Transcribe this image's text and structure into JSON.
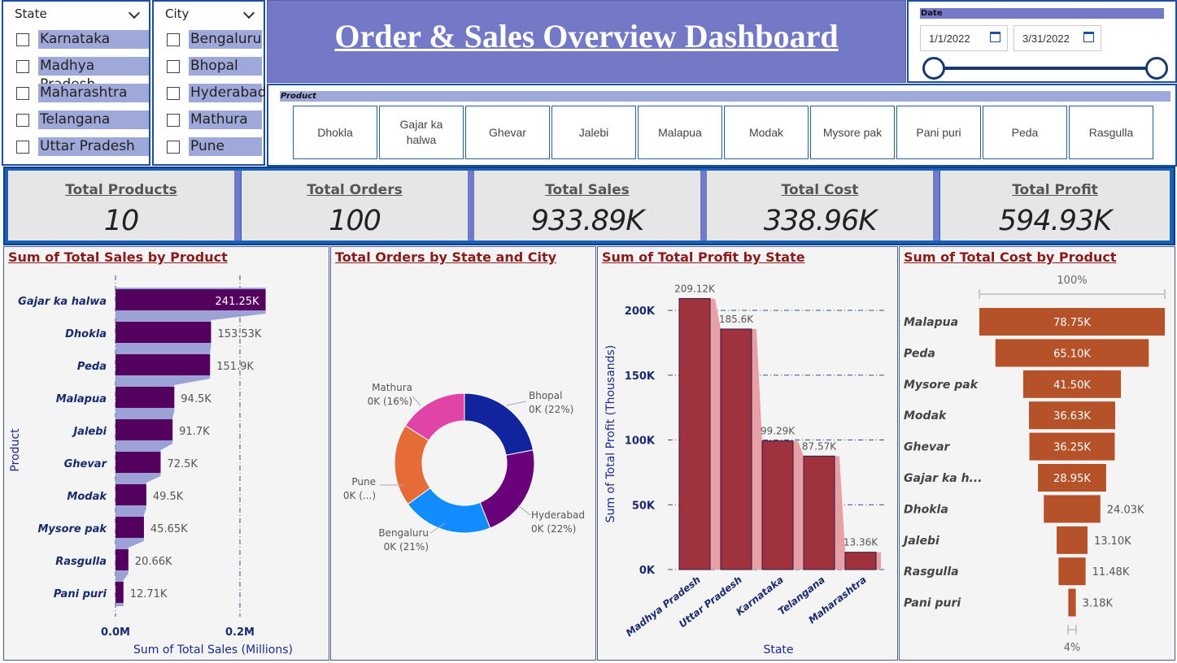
{
  "state_slicer": {
    "header": "State",
    "items": [
      "Karnataka",
      "Madhya Pradesh",
      "Maharashtra",
      "Telangana",
      "Uttar Pradesh"
    ]
  },
  "city_slicer": {
    "header": "City",
    "items": [
      "Bengaluru",
      "Bhopal",
      "Hyderabad",
      "Mathura",
      "Pune"
    ]
  },
  "title": "Order & Sales Overview Dashboard",
  "date_filter": {
    "header": "Date",
    "start": "1/1/2022",
    "end": "3/31/2022"
  },
  "product_filter": {
    "header": "Product",
    "items": [
      "Dhokla",
      "Gajar ka halwa",
      "Ghevar",
      "Jalebi",
      "Malapua",
      "Modak",
      "Mysore pak",
      "Pani puri",
      "Peda",
      "Rasgulla"
    ]
  },
  "kpis": [
    {
      "label": "Total Products",
      "value": "10"
    },
    {
      "label": "Total Orders",
      "value": "100"
    },
    {
      "label": "Total Sales",
      "value": "933.89K"
    },
    {
      "label": "Total Cost",
      "value": "338.96K"
    },
    {
      "label": "Total Profit",
      "value": "594.93K"
    }
  ],
  "colors": {
    "accent": "#7479c7",
    "bar_purple": "#54005e",
    "bar_red": "#a0323e",
    "bar_orange": "#b6522a",
    "title_red": "#8b1a1a"
  },
  "chart_data": [
    {
      "type": "bar",
      "orientation": "horizontal",
      "title": "Sum of Total Sales by Product",
      "xlabel": "Sum of Total Sales (Millions)",
      "ylabel": "Product",
      "x_ticks": [
        "0.0M",
        "0.2M"
      ],
      "xlim": [
        0,
        0.27
      ],
      "categories": [
        "Gajar ka halwa",
        "Dhokla",
        "Peda",
        "Malapua",
        "Jalebi",
        "Ghevar",
        "Modak",
        "Mysore pak",
        "Rasgulla",
        "Pani puri"
      ],
      "values": [
        241.25,
        153.53,
        151.9,
        94.5,
        91.7,
        72.5,
        49.5,
        45.65,
        20.66,
        12.71
      ],
      "value_labels": [
        "241.25K",
        "153.53K",
        "151.9K",
        "94.5K",
        "91.7K",
        "72.5K",
        "49.5K",
        "45.65K",
        "20.66K",
        "12.71K"
      ],
      "value_unit": "K"
    },
    {
      "type": "pie",
      "donut": true,
      "title": "Total Orders by State and City",
      "slices": [
        {
          "name": "Bhopal",
          "label": "0K (22%)",
          "percent": 22,
          "color": "#12239e"
        },
        {
          "name": "Hyderabad",
          "label": "0K (22%)",
          "percent": 22,
          "color": "#6b007b"
        },
        {
          "name": "Bengaluru",
          "label": "0K (21%)",
          "percent": 21,
          "color": "#118dff"
        },
        {
          "name": "Pune",
          "label": "0K (...)",
          "percent": 19,
          "color": "#e66c37"
        },
        {
          "name": "Mathura",
          "label": "0K (16%)",
          "percent": 16,
          "color": "#e044a7"
        }
      ]
    },
    {
      "type": "bar",
      "title": "Sum of Total Profit by State",
      "xlabel": "State",
      "ylabel": "Sum of Total Profit (Thousands)",
      "y_ticks": [
        "0K",
        "50K",
        "100K",
        "150K",
        "200K"
      ],
      "ylim": [
        0,
        220
      ],
      "categories": [
        "Madhya Pradesh",
        "Uttar Pradesh",
        "Karnataka",
        "Telangana",
        "Maharashtra"
      ],
      "values": [
        209.12,
        185.6,
        99.29,
        87.57,
        13.36
      ],
      "value_labels": [
        "209.12K",
        "185.6K",
        "99.29K",
        "87.57K",
        "13.36K"
      ],
      "value_unit": "K"
    },
    {
      "type": "funnel",
      "title": "Sum of Total Cost by Product",
      "top_label": "100%",
      "bottom_label": "4%",
      "categories": [
        "Malapua",
        "Peda",
        "Mysore pak",
        "Modak",
        "Ghevar",
        "Gajar ka h...",
        "Dhokla",
        "Jalebi",
        "Rasgulla",
        "Pani puri"
      ],
      "values": [
        78.75,
        65.1,
        41.5,
        36.63,
        36.25,
        28.95,
        24.03,
        13.1,
        11.48,
        3.18
      ],
      "value_labels": [
        "78.75K",
        "65.10K",
        "41.50K",
        "36.63K",
        "36.25K",
        "28.95K",
        "24.03K",
        "13.10K",
        "11.48K",
        "3.18K"
      ],
      "value_unit": "K"
    }
  ]
}
